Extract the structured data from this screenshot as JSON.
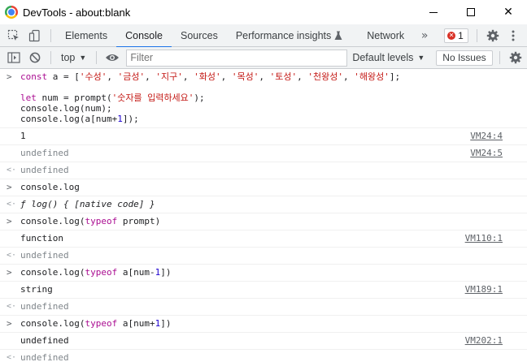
{
  "window": {
    "title": "DevTools - about:blank",
    "minimize_icon": "minimize-icon",
    "maximize_icon": "maximize-icon",
    "close_glyph": "✕"
  },
  "tabs": {
    "items": [
      "Elements",
      "Console",
      "Sources",
      "Performance insights",
      "Network"
    ],
    "active": "Console",
    "performance_suffix_icon": "flask-icon",
    "more_glyph": "»",
    "error_count": "1"
  },
  "console_toolbar": {
    "context": "top",
    "filter_placeholder": "Filter",
    "levels_label": "Default levels",
    "issues_label": "No Issues"
  },
  "console": {
    "entries": [
      {
        "type": "input",
        "code": [
          {
            "t": "kw",
            "v": "const"
          },
          {
            "t": "plain",
            "v": " a = ["
          },
          {
            "t": "str",
            "v": "'수성'"
          },
          {
            "t": "plain",
            "v": ", "
          },
          {
            "t": "str",
            "v": "'금성'"
          },
          {
            "t": "plain",
            "v": ", "
          },
          {
            "t": "str",
            "v": "'지구'"
          },
          {
            "t": "plain",
            "v": ", "
          },
          {
            "t": "str",
            "v": "'화성'"
          },
          {
            "t": "plain",
            "v": ", "
          },
          {
            "t": "str",
            "v": "'목성'"
          },
          {
            "t": "plain",
            "v": ", "
          },
          {
            "t": "str",
            "v": "'토성'"
          },
          {
            "t": "plain",
            "v": ", "
          },
          {
            "t": "str",
            "v": "'천왕성'"
          },
          {
            "t": "plain",
            "v": ", "
          },
          {
            "t": "str",
            "v": "'해왕성'"
          },
          {
            "t": "plain",
            "v": "];\n\n"
          },
          {
            "t": "kw",
            "v": "let"
          },
          {
            "t": "plain",
            "v": " num = prompt("
          },
          {
            "t": "str",
            "v": "'숫자를 입력하세요'"
          },
          {
            "t": "plain",
            "v": ");\nconsole.log(num);\nconsole.log(a[num+"
          },
          {
            "t": "num",
            "v": "1"
          },
          {
            "t": "plain",
            "v": "]);"
          }
        ]
      },
      {
        "type": "log",
        "text": "1",
        "source": "VM24:4"
      },
      {
        "type": "log-muted",
        "text": "undefined",
        "source": "VM24:5"
      },
      {
        "type": "result",
        "text": "undefined"
      },
      {
        "type": "input",
        "code": [
          {
            "t": "plain",
            "v": "console.log"
          }
        ]
      },
      {
        "type": "result-fn",
        "code": [
          {
            "t": "fn",
            "v": "ƒ log() { [native code] }"
          }
        ]
      },
      {
        "type": "input",
        "code": [
          {
            "t": "plain",
            "v": "console.log("
          },
          {
            "t": "kw",
            "v": "typeof"
          },
          {
            "t": "plain",
            "v": " prompt)"
          }
        ]
      },
      {
        "type": "log",
        "text": "function",
        "source": "VM110:1"
      },
      {
        "type": "result",
        "text": "undefined"
      },
      {
        "type": "input",
        "code": [
          {
            "t": "plain",
            "v": "console.log("
          },
          {
            "t": "kw",
            "v": "typeof"
          },
          {
            "t": "plain",
            "v": " a[num-"
          },
          {
            "t": "num",
            "v": "1"
          },
          {
            "t": "plain",
            "v": "])"
          }
        ]
      },
      {
        "type": "log",
        "text": "string",
        "source": "VM189:1"
      },
      {
        "type": "result",
        "text": "undefined"
      },
      {
        "type": "input",
        "code": [
          {
            "t": "plain",
            "v": "console.log("
          },
          {
            "t": "kw",
            "v": "typeof"
          },
          {
            "t": "plain",
            "v": " a[num+"
          },
          {
            "t": "num",
            "v": "1"
          },
          {
            "t": "plain",
            "v": "])"
          }
        ]
      },
      {
        "type": "log",
        "text": "undefined",
        "source": "VM202:1"
      },
      {
        "type": "result",
        "text": "undefined"
      }
    ]
  },
  "colors": {
    "accent": "#1a73e8",
    "keyword": "#aa0d91",
    "string": "#c41a16",
    "number": "#1c00cf",
    "error": "#d93025"
  }
}
